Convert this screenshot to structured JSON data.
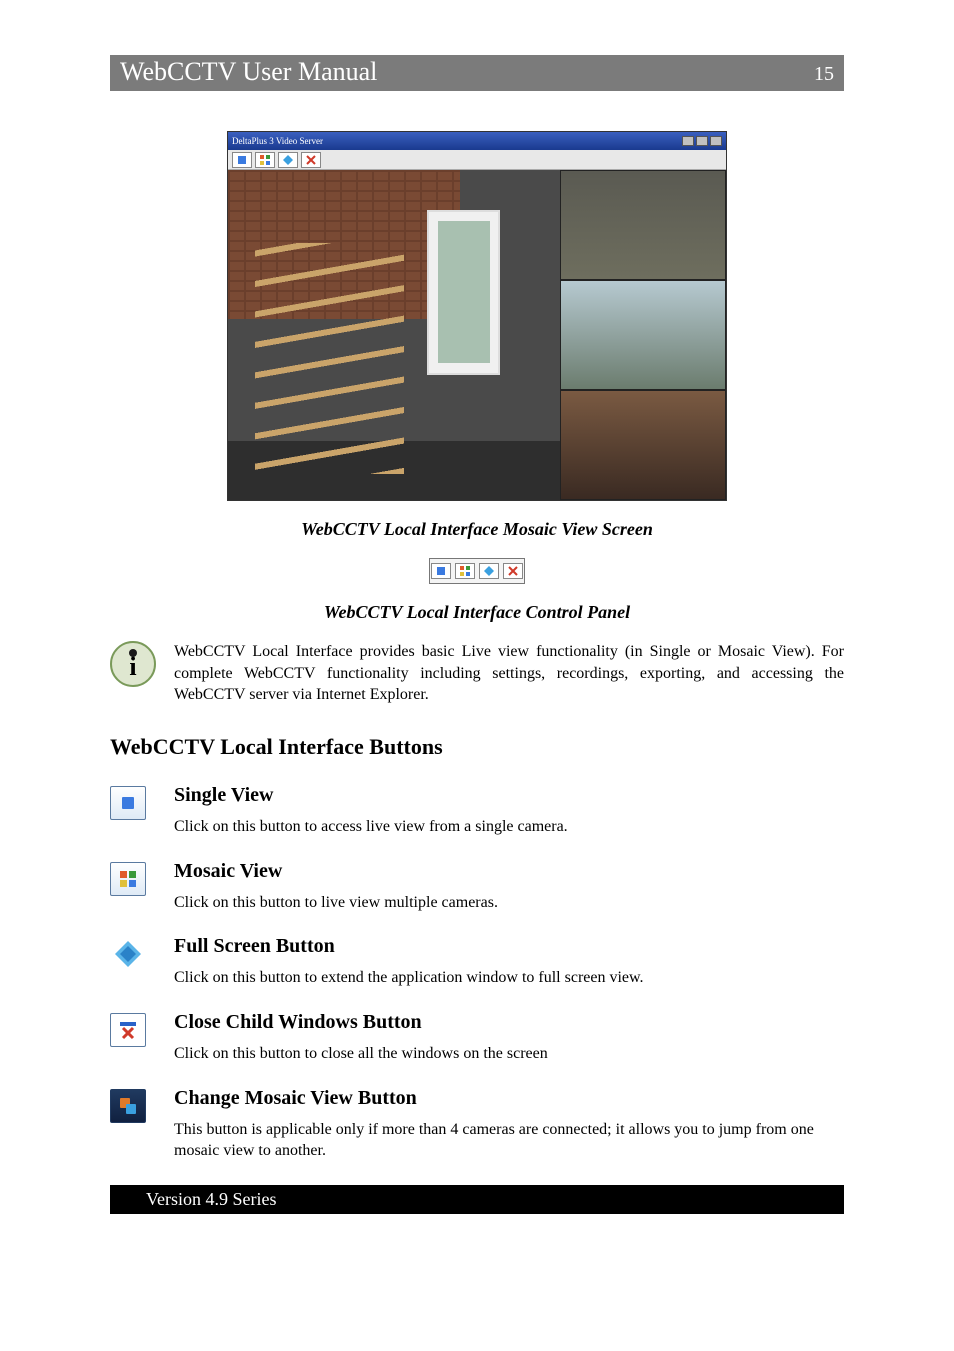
{
  "header": {
    "title": "WebCCTV User Manual",
    "page": "15"
  },
  "screenshot": {
    "window_title": "DeltaPlus 3 Video Server"
  },
  "captions": {
    "mosaic_screen": "WebCCTV Local Interface Mosaic View Screen",
    "control_panel": "WebCCTV Local Interface Control Panel"
  },
  "note": "WebCCTV Local Interface provides basic Live view functionality (in Single or Mosaic View).  For complete WebCCTV functionality including settings, recordings, exporting, and accessing the WebCCTV server via Internet Explorer.",
  "section_heading": "WebCCTV Local Interface Buttons",
  "buttons": {
    "single": {
      "title": "Single View",
      "desc": "Click on this button to access live view from a single camera."
    },
    "mosaic": {
      "title": "Mosaic View",
      "desc": "Click on this button to live view multiple cameras."
    },
    "fullscreen": {
      "title": "Full Screen Button",
      "desc": "Click on this button to extend the application window to full screen view."
    },
    "close": {
      "title": "Close Child Windows Button",
      "desc": "Click on this button to close all the windows on the screen"
    },
    "change": {
      "title": "Change Mosaic View Button",
      "desc": "This button is applicable only if more than 4 cameras are connected; it allows you to jump from one mosaic view to another."
    }
  },
  "footer": "Version 4.9 Series",
  "colors": {
    "accent_red": "#d03a2a",
    "accent_blue": "#2a62c8",
    "accent_green": "#2a9a4a"
  }
}
